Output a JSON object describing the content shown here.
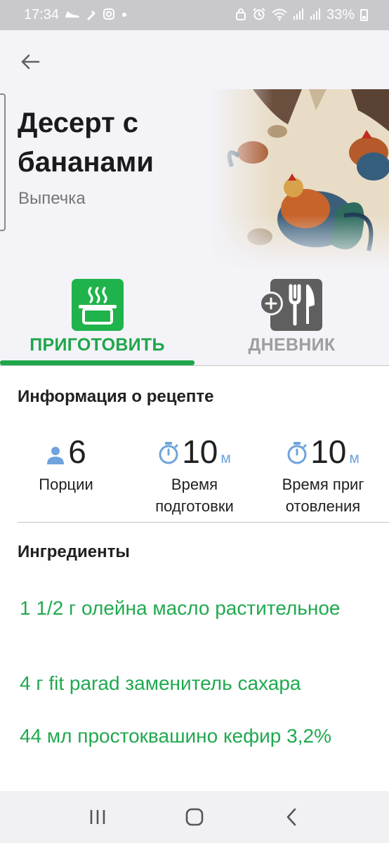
{
  "status_bar": {
    "time": "17:34",
    "battery_text": "33%",
    "icons_left": [
      "shoe-icon",
      "dropper-icon",
      "instagram-icon",
      "dot-icon"
    ],
    "icons_right": [
      "lock-icon",
      "alarm-icon",
      "wifi-icon",
      "signal-icon",
      "signal-icon",
      "battery-icon"
    ]
  },
  "header": {
    "back_icon": "arrow-left-icon"
  },
  "recipe": {
    "title": "Десерт с бананами",
    "category": "Выпечка"
  },
  "tabs": [
    {
      "label": "ПРИГОТОВИТЬ",
      "icon": "cooking-pot-icon",
      "active": true
    },
    {
      "label": "ДНЕВНИК",
      "icon": "add-cutlery-icon",
      "active": false
    }
  ],
  "info": {
    "title": "Информация о рецепте",
    "servings": {
      "value": "6",
      "label": "Порции",
      "icon": "person-icon"
    },
    "prep_time": {
      "value": "10",
      "unit": "м",
      "label": "Время подготовки",
      "icon": "stopwatch-icon"
    },
    "cook_time": {
      "value": "10",
      "unit": "м",
      "label": "Время приг отовления",
      "icon": "stopwatch-icon"
    }
  },
  "ingredients": {
    "title": "Ингредиенты",
    "items": [
      "1 1/2 г олейна масло растительное",
      "4 г fit parad заменитель сахара",
      "44 мл простоквашино кефир 3,2%"
    ]
  },
  "nav_bar": {
    "buttons": [
      "recents-icon",
      "home-icon",
      "back-icon"
    ]
  },
  "colors": {
    "accent_green": "#1fb34b",
    "text_green": "#20a94f",
    "inactive_gray": "#9e9e9e",
    "unit_blue": "#6ea3dc",
    "status_bar_bg": "#c9c9cd",
    "header_bg": "#f3f3f8"
  }
}
